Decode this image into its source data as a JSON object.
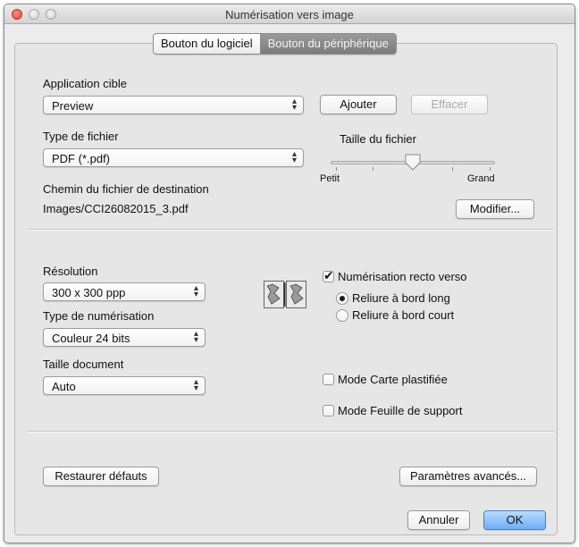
{
  "window": {
    "title": "Numérisation vers image"
  },
  "tabs": [
    {
      "label": "Bouton du logiciel",
      "active": false
    },
    {
      "label": "Bouton du périphérique",
      "active": true
    }
  ],
  "target_app": {
    "label": "Application cible",
    "value": "Preview",
    "add_label": "Ajouter",
    "delete_label": "Effacer"
  },
  "file_type": {
    "label": "Type de fichier",
    "value": "PDF (*.pdf)"
  },
  "file_size": {
    "label": "Taille du fichier",
    "min_label": "Petit",
    "max_label": "Grand",
    "level": 0.5
  },
  "destination": {
    "label": "Chemin du fichier de destination",
    "path": "Images/CCI26082015_3.pdf",
    "modify_label": "Modifier..."
  },
  "resolution": {
    "label": "Résolution",
    "value": "300 x 300 ppp"
  },
  "scan_type": {
    "label": "Type de numérisation",
    "value": "Couleur 24 bits"
  },
  "doc_size": {
    "label": "Taille document",
    "value": "Auto"
  },
  "duplex": {
    "label": "Numérisation recto verso",
    "checked": true,
    "options": [
      {
        "label": "Reliure à bord long",
        "selected": true
      },
      {
        "label": "Reliure à bord court",
        "selected": false
      }
    ]
  },
  "plastic_card": {
    "label": "Mode Carte plastifiée",
    "checked": false
  },
  "carrier_sheet": {
    "label": "Mode Feuille de support",
    "checked": false
  },
  "footer": {
    "restore_label": "Restaurer défauts",
    "advanced_label": "Paramètres avancés...",
    "cancel_label": "Annuler",
    "ok_label": "OK"
  },
  "icons": {
    "duplex": "duplex-pages-icon"
  }
}
